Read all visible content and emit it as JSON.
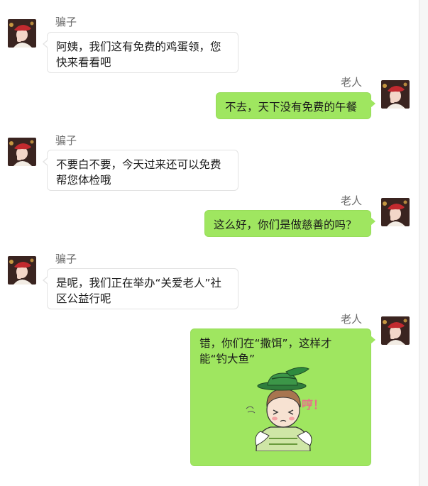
{
  "messages": [
    {
      "sender": "骗子",
      "text": "阿姨，我们这有免费的鸡蛋领，您快来看看吧"
    },
    {
      "sender": "老人",
      "text": "不去，天下没有免费的午餐"
    },
    {
      "sender": "骗子",
      "text": "不要白不要，今天过来还可以免费帮您体检哦"
    },
    {
      "sender": "老人",
      "text": "这么好，你们是做慈善的吗？"
    },
    {
      "sender": "骗子",
      "text": "是呢，我们正在举办“关爱老人”社区公益行呢"
    },
    {
      "sender": "老人",
      "text": "错，你们在“撒饵”，这样才能“钓大鱼”",
      "sticker_text": "哼！"
    }
  ],
  "colors": {
    "right_bubble": "#9fe660",
    "left_bubble": "#ffffff",
    "name": "#6b6b6b"
  },
  "icons": [
    "avatar-woman-red-beret",
    "sticker-woman-green-hat"
  ]
}
